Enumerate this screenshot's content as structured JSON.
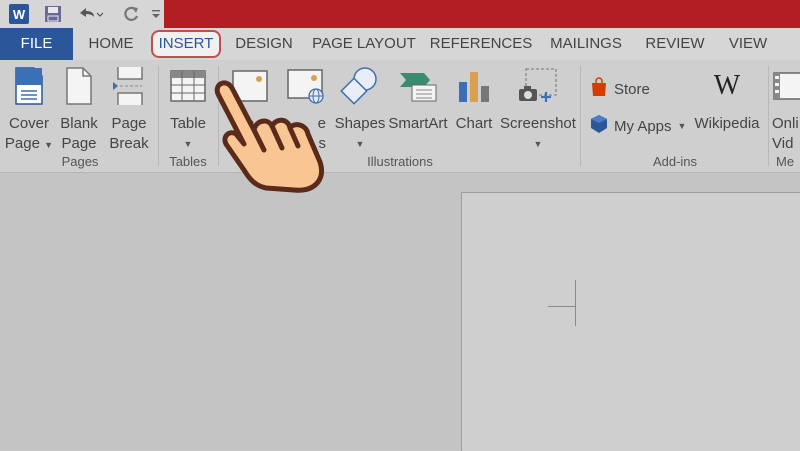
{
  "qat": {
    "word_icon": "W",
    "save_icon": "save-icon",
    "undo_icon": "undo-icon",
    "redo_icon": "redo-icon",
    "customize_icon": "customize-icon"
  },
  "colors": {
    "title_bar": "#b21e22",
    "file_tab": "#2b579a",
    "highlight": "#c0504d"
  },
  "tabs": [
    {
      "label": "FILE"
    },
    {
      "label": "HOME"
    },
    {
      "label": "INSERT"
    },
    {
      "label": "DESIGN"
    },
    {
      "label": "PAGE LAYOUT"
    },
    {
      "label": "REFERENCES"
    },
    {
      "label": "MAILINGS"
    },
    {
      "label": "REVIEW"
    },
    {
      "label": "VIEW"
    }
  ],
  "ribbon": {
    "pages": {
      "group_label": "Pages",
      "cover_page": {
        "line1": "Cover",
        "line2": "Page"
      },
      "blank_page": {
        "line1": "Blank",
        "line2": "Page"
      },
      "page_break": {
        "line1": "Page",
        "line2": "Break"
      }
    },
    "tables": {
      "group_label": "Tables",
      "table": {
        "line1": "Table"
      }
    },
    "illustrations": {
      "group_label": "Illustrations",
      "pictures_partial": {
        "line1": "",
        "line2": "e"
      },
      "online_pictures_partial": {
        "line1": "e",
        "line2": "s"
      },
      "shapes": {
        "line1": "Shapes"
      },
      "smartart": {
        "line1": "SmartArt"
      },
      "chart": {
        "line1": "Chart"
      },
      "screenshot": {
        "line1": "Screenshot"
      }
    },
    "addins": {
      "group_label": "Add-ins",
      "store": "Store",
      "my_apps": "My Apps",
      "wikipedia": "Wikipedia"
    },
    "media": {
      "group_label": "Me",
      "online_video": {
        "line1": "Onli",
        "line2": "Vid"
      }
    }
  }
}
